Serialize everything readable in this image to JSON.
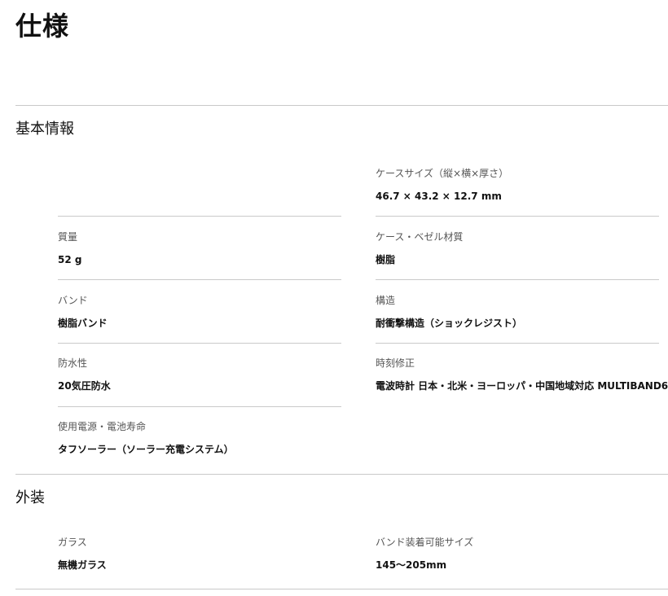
{
  "page": {
    "title": "仕様"
  },
  "sections": {
    "basic": {
      "heading": "基本情報",
      "items": [
        {
          "label": "ケースサイズ（縦×横×厚さ）",
          "value": "46.7 × 43.2 × 12.7 mm"
        },
        {
          "label": "質量",
          "value": "52 g"
        },
        {
          "label": "ケース・ベゼル材質",
          "value": "樹脂"
        },
        {
          "label": "バンド",
          "value": "樹脂バンド"
        },
        {
          "label": "構造",
          "value": "耐衝撃構造（ショックレジスト）"
        },
        {
          "label": "防水性",
          "value": "20気圧防水"
        },
        {
          "label": "時刻修正",
          "value": "電波時計 日本・北米・ヨーロッパ・中国地域対応 MULTIBAND6"
        },
        {
          "label": "使用電源・電池寿命",
          "value": "タフソーラー（ソーラー充電システム）"
        }
      ]
    },
    "exterior": {
      "heading": "外装",
      "items": [
        {
          "label": "ガラス",
          "value": "無機ガラス"
        },
        {
          "label": "バンド装着可能サイズ",
          "value": "145〜205mm"
        }
      ]
    }
  }
}
